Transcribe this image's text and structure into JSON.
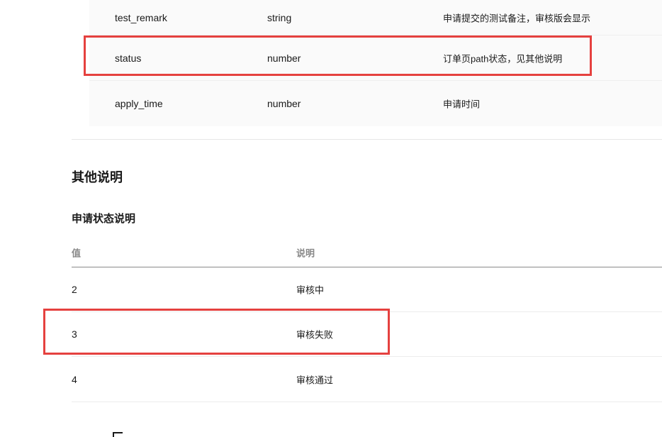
{
  "params": {
    "rows": [
      {
        "name": "test_remark",
        "type": "string",
        "desc": "申请提交的测试备注，审核版会显示"
      },
      {
        "name": "status",
        "type": "number",
        "desc": "订单页path状态，见其他说明"
      },
      {
        "name": "apply_time",
        "type": "number",
        "desc": "申请时间"
      }
    ]
  },
  "other": {
    "heading": "其他说明",
    "status_section": {
      "title": "申请状态说明",
      "headers": {
        "value": "值",
        "desc": "说明"
      },
      "rows": [
        {
          "value": "2",
          "desc": "审核中"
        },
        {
          "value": "3",
          "desc": "审核失败"
        },
        {
          "value": "4",
          "desc": "审核通过"
        }
      ]
    }
  },
  "colors": {
    "highlight": "#e5413f",
    "row_bg": "#fafafa"
  }
}
